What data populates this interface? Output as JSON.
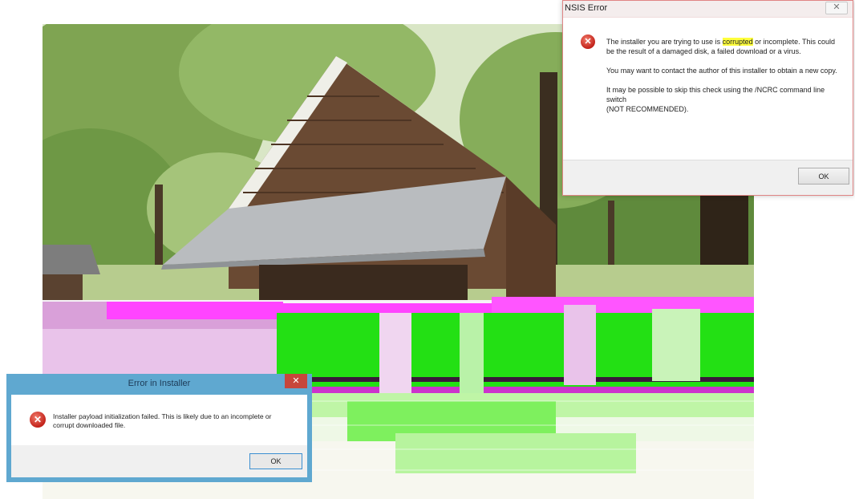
{
  "nsis_dialog": {
    "title": "NSIS Error",
    "close_glyph": "✕",
    "icon": "error-icon",
    "message_para1_before": "The installer you are trying to use is ",
    "message_para1_highlight": "corrupted",
    "message_para1_after": " or incomplete. This could be the result of a damaged disk, a failed download or a virus.",
    "message_para2": "You may want to contact the author of this installer to obtain a new copy.",
    "message_para3_line1": "It may be possible to skip this check using the /NCRC command line switch",
    "message_para3_line2": "(NOT RECOMMENDED).",
    "ok_label": "OK",
    "highlight_color": "#ffff3d"
  },
  "installer_dialog": {
    "title": "Error in Installer",
    "close_glyph": "✕",
    "icon": "error-icon",
    "message": "Installer payload initialization failed. This is likely due to an incomplete or corrupt downloaded file.",
    "ok_label": "OK",
    "frame_color": "#5fa8d0"
  },
  "background": {
    "subject": "photo",
    "glitch_colors": [
      "#ff33ff",
      "#22ee11"
    ]
  }
}
